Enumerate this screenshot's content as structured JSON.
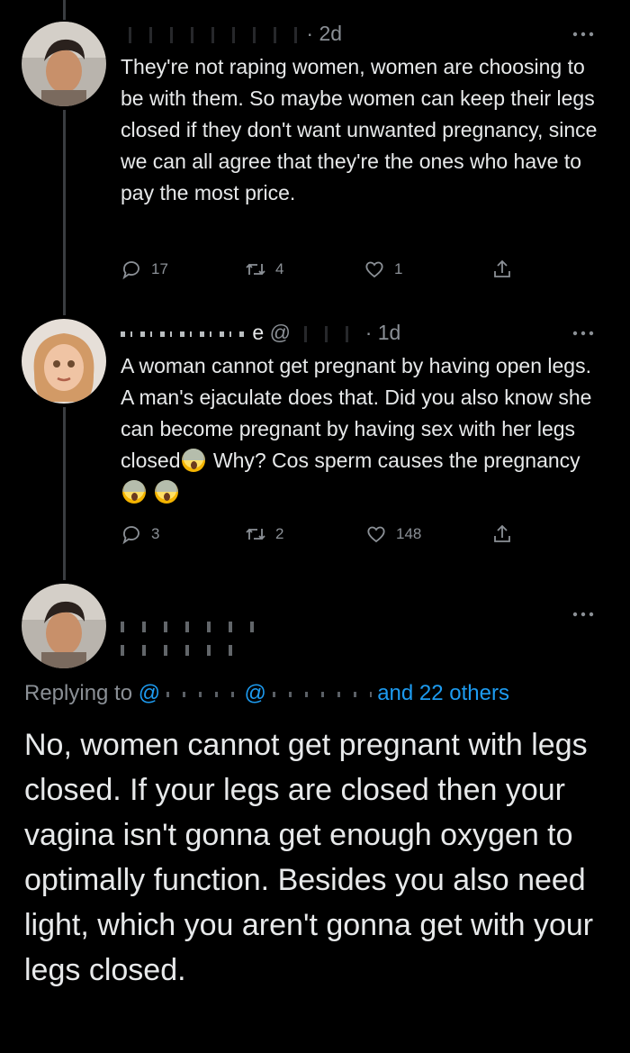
{
  "tweets": [
    {
      "time": "· 2d",
      "text": "They're not raping women, women are choosing to be with them. So maybe women can keep their legs closed if they don't want unwanted pregnancy, since we can all agree that they're the ones who have to pay the most price.",
      "replies": "17",
      "retweets": "4",
      "likes": "1"
    },
    {
      "name_fragment": "e",
      "handle_fragment": "@",
      "time": "· 1d",
      "text_part1": "A woman cannot get pregnant by having open legs. A man's ejaculate does that. Did you also know she can become pregnant by having sex with her legs closed",
      "text_part2": " Why? Cos sperm causes the pregnancy",
      "replies": "3",
      "retweets": "2",
      "likes": "148"
    }
  ],
  "main_reply": {
    "replying_prefix": "Replying to ",
    "mention_start": "@",
    "mention_mid": "@",
    "replying_suffix": "and 22 others",
    "text": "No, women cannot get pregnant with legs closed. If your legs are closed then your vagina isn't gonna get enough oxygen to optimally function. Besides you also need light, which you aren't gonna get with your legs closed."
  },
  "icons": [
    "reply-icon",
    "retweet-icon",
    "like-icon",
    "share-icon",
    "more-icon"
  ],
  "colors": {
    "background": "#000000",
    "text": "#e7e9ea",
    "muted": "#8b9096",
    "link": "#1d9bf0"
  }
}
